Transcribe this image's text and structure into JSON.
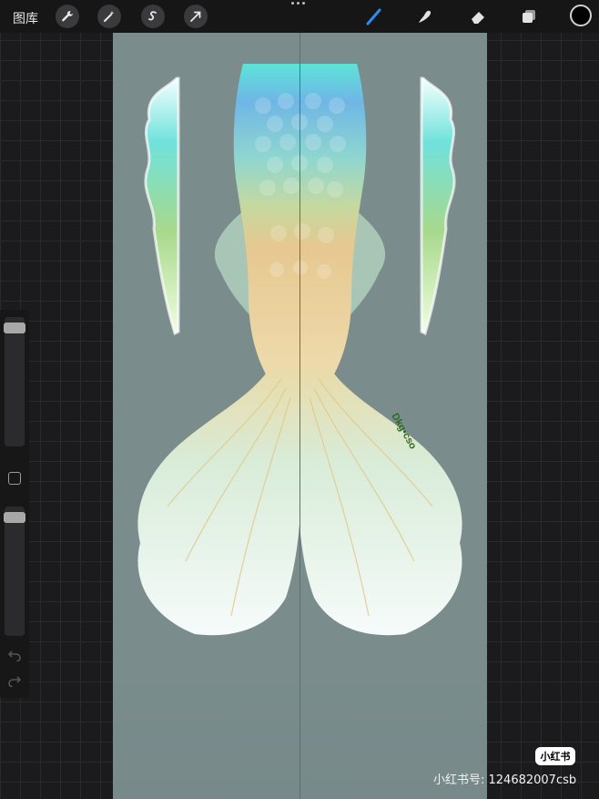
{
  "topbar": {
    "gallery_label": "图库",
    "tools_left": [
      "wrench-icon",
      "magic-wand-icon",
      "selection-icon",
      "transform-arrow-icon"
    ],
    "tools_right": [
      "brush-icon",
      "smudge-icon",
      "eraser-icon",
      "layers-icon"
    ],
    "active_tool": "brush-icon",
    "current_color": "#000000"
  },
  "canvas": {
    "background": "#7a8d8c",
    "signature": "Dkg•cso"
  },
  "watermark": {
    "badge": "小红书",
    "id_text": "小红书号: 124682007csb"
  }
}
